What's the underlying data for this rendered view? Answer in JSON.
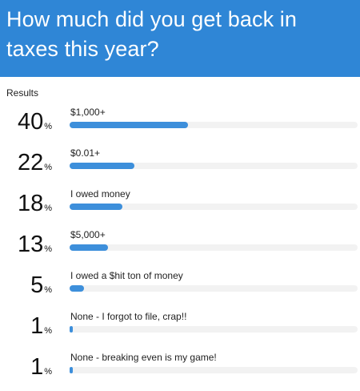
{
  "poll": {
    "question": "How much did you get back in taxes this year?",
    "results_label": "Results",
    "percent_sign": "%",
    "accent_color": "#3d8fdb",
    "header_color": "#2f86d6",
    "options": [
      {
        "label": "$1,000+",
        "percent": "40"
      },
      {
        "label": "$0.01+",
        "percent": "22"
      },
      {
        "label": "I owed money",
        "percent": "18"
      },
      {
        "label": "$5,000+",
        "percent": "13"
      },
      {
        "label": "I owed a $hit ton of money",
        "percent": "5"
      },
      {
        "label": "None - I forgot to file, crap!!",
        "percent": "1"
      },
      {
        "label": "None - breaking even is my game!",
        "percent": "1"
      }
    ]
  }
}
